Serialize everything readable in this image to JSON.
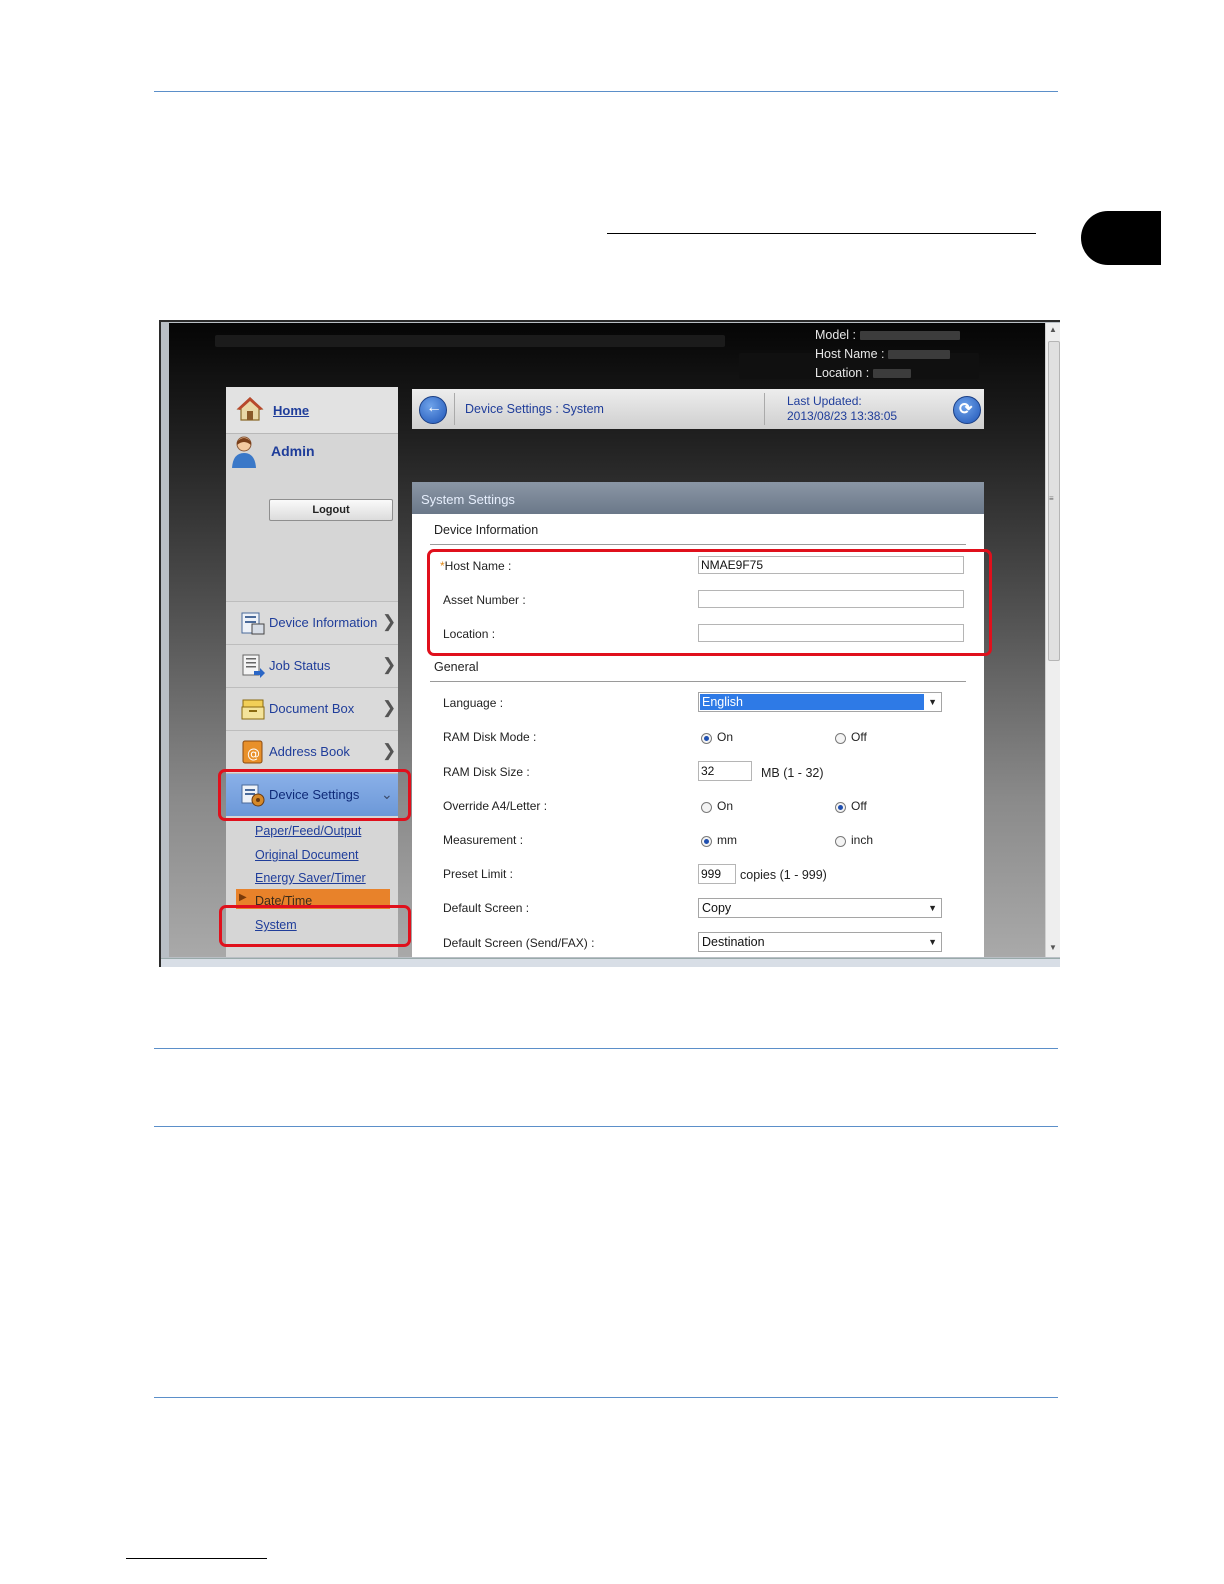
{
  "header": {
    "model_label": "Model :",
    "host_name_label": "Host Name :",
    "location_label": "Location :"
  },
  "sidebar": {
    "home": "Home",
    "admin": "Admin",
    "logout": "Logout",
    "nav": [
      {
        "label": "Device Information",
        "icon": "device-information-icon"
      },
      {
        "label": "Job Status",
        "icon": "job-status-icon"
      },
      {
        "label": "Document Box",
        "icon": "document-box-icon"
      },
      {
        "label": "Address Book",
        "icon": "address-book-icon"
      },
      {
        "label": "Device Settings",
        "icon": "device-settings-icon"
      }
    ],
    "sub_items": [
      "Paper/Feed/Output",
      "Original Document",
      "Energy Saver/Timer",
      "Date/Time",
      "System"
    ]
  },
  "breadcrumb": {
    "path": "Device Settings : System",
    "last_updated_label": "Last Updated:",
    "last_updated_value": "2013/08/23 13:38:05"
  },
  "panel": {
    "title": "System Settings",
    "device_info_heading": "Device Information",
    "host_name_label": "Host Name :",
    "host_name_value": "NMAE9F75",
    "asset_number_label": "Asset Number :",
    "asset_number_value": "",
    "location_label": "Location :",
    "location_value": "",
    "general_heading": "General",
    "language_label": "Language :",
    "language_value": "English",
    "ram_disk_mode_label": "RAM Disk Mode :",
    "ram_disk_size_label": "RAM Disk Size :",
    "ram_disk_size_value": "32",
    "ram_disk_size_unit": "MB (1 - 32)",
    "override_label": "Override A4/Letter :",
    "measurement_label": "Measurement :",
    "preset_limit_label": "Preset Limit :",
    "preset_limit_value": "999",
    "preset_limit_unit": "copies (1 - 999)",
    "default_screen_label": "Default Screen :",
    "default_screen_value": "Copy",
    "default_screen_sendfax_label": "Default Screen (Send/FAX) :",
    "default_screen_sendfax_value": "Destination",
    "on": "On",
    "off": "Off",
    "mm": "mm",
    "inch": "inch"
  },
  "colors": {
    "highlight_red": "#e0101c",
    "link_blue": "#1f3d9a",
    "active_orange": "#e8822a",
    "rule_blue": "#5b8fc9"
  }
}
